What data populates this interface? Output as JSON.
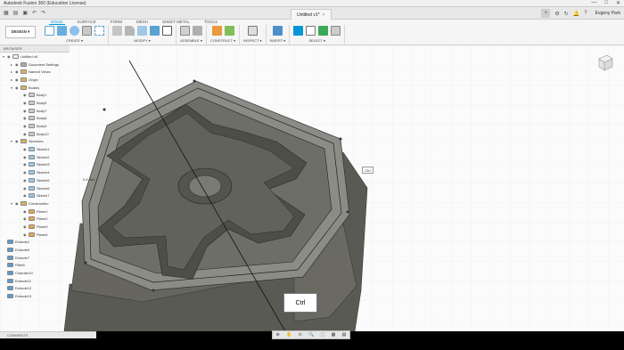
{
  "window": {
    "title": "Autodesk Fusion 360 (Education License)",
    "controls": [
      "—",
      "□",
      "✕"
    ]
  },
  "qat": {
    "document_tab": "Untitled v1*",
    "tab_close": "×",
    "user": "Evgeny Park",
    "plus": "+"
  },
  "workspace_button": "DESIGN ▾",
  "workspace_tabs": [
    "SOLID",
    "SURFACE",
    "FORM",
    "MESH",
    "SHEET METAL",
    "TOOLS"
  ],
  "ribbon_groups": [
    {
      "label": "CREATE ▾",
      "icons": [
        "sketch-icon",
        "extrude-icon",
        "revolve-icon",
        "hole-icon",
        "box-icon"
      ]
    },
    {
      "label": "MODIFY ▾",
      "icons": [
        "press-pull-icon",
        "fillet-icon",
        "chamfer-icon",
        "shell-icon",
        "move-icon"
      ]
    },
    {
      "label": "ASSEMBLE ▾",
      "icons": [
        "new-component-icon",
        "joint-icon"
      ]
    },
    {
      "label": "CONSTRUCT ▾",
      "icons": [
        "offset-plane-icon",
        "axis-icon"
      ]
    },
    {
      "label": "INSPECT ▾",
      "icons": [
        "measure-icon"
      ]
    },
    {
      "label": "INSERT ▾",
      "icons": [
        "insert-image-icon"
      ]
    },
    {
      "label": "SELECT ▾",
      "icons": [
        "select-arrow-icon",
        "select-window-icon",
        "select-box-icon",
        "select-body-icon"
      ]
    }
  ],
  "browser": {
    "title": "BROWSER",
    "items": [
      {
        "label": "Untitled v8",
        "level": 0,
        "twisty": "▾",
        "icon": "component"
      },
      {
        "label": "Document Settings",
        "level": 1,
        "twisty": "▸",
        "icon": "gear"
      },
      {
        "label": "Named Views",
        "level": 1,
        "twisty": "▸",
        "icon": "folder"
      },
      {
        "label": "Origin",
        "level": 1,
        "twisty": "▸",
        "icon": "folder"
      },
      {
        "label": "Bodies",
        "level": 1,
        "twisty": "▾",
        "icon": "folder"
      },
      {
        "label": "Body1",
        "level": 2,
        "twisty": "",
        "icon": "body"
      },
      {
        "label": "Body5",
        "level": 2,
        "twisty": "",
        "icon": "body"
      },
      {
        "label": "Body7",
        "level": 2,
        "twisty": "",
        "icon": "body"
      },
      {
        "label": "Body8",
        "level": 2,
        "twisty": "",
        "icon": "body"
      },
      {
        "label": "Body9",
        "level": 2,
        "twisty": "",
        "icon": "body"
      },
      {
        "label": "Body10",
        "level": 2,
        "twisty": "",
        "icon": "body"
      },
      {
        "label": "Sketches",
        "level": 1,
        "twisty": "▾",
        "icon": "folder"
      },
      {
        "label": "Sketch1",
        "level": 2,
        "twisty": "",
        "icon": "sketch"
      },
      {
        "label": "Sketch2",
        "level": 2,
        "twisty": "",
        "icon": "sketch"
      },
      {
        "label": "Sketch3",
        "level": 2,
        "twisty": "",
        "icon": "sketch"
      },
      {
        "label": "Sketch4",
        "level": 2,
        "twisty": "",
        "icon": "sketch"
      },
      {
        "label": "Sketch5",
        "level": 2,
        "twisty": "",
        "icon": "sketch"
      },
      {
        "label": "Sketch6",
        "level": 2,
        "twisty": "",
        "icon": "sketch"
      },
      {
        "label": "Sketch7",
        "level": 2,
        "twisty": "",
        "icon": "sketch"
      },
      {
        "label": "Construction",
        "level": 1,
        "twisty": "▾",
        "icon": "folder"
      },
      {
        "label": "Plane1",
        "level": 2,
        "twisty": "",
        "icon": "plane"
      },
      {
        "label": "Plane2",
        "level": 2,
        "twisty": "",
        "icon": "plane"
      },
      {
        "label": "Plane3",
        "level": 2,
        "twisty": "",
        "icon": "plane"
      },
      {
        "label": "Plane4",
        "level": 2,
        "twisty": "",
        "icon": "plane"
      },
      {
        "label": "Extrude1",
        "level": 0,
        "twisty": "",
        "icon": "feature"
      },
      {
        "label": "Extrude6",
        "level": 0,
        "twisty": "",
        "icon": "feature"
      },
      {
        "label": "Extrude7",
        "level": 0,
        "twisty": "",
        "icon": "feature"
      },
      {
        "label": "Fillet5",
        "level": 0,
        "twisty": "",
        "icon": "feature"
      },
      {
        "label": "Chamfer10",
        "level": 0,
        "twisty": "",
        "icon": "feature"
      },
      {
        "label": "Extrude11",
        "level": 0,
        "twisty": "",
        "icon": "feature"
      },
      {
        "label": "Extrude12",
        "level": 0,
        "twisty": "",
        "icon": "feature"
      },
      {
        "label": "Extrude13",
        "level": 0,
        "twisty": "",
        "icon": "feature"
      }
    ]
  },
  "viewport": {
    "callout_text": "Ctrl",
    "cursor_tooltip": "Ctrl",
    "dimension_text": "0.5 mm"
  },
  "comments_label": "COMMENTS",
  "nav_toolbar": [
    "⊕",
    "✋",
    "⊙",
    "🔍",
    "⬚",
    "▦",
    "▤"
  ],
  "colors": {
    "accent": "#0696d7",
    "model_body": "#5f5f58",
    "model_top": "#767670"
  }
}
